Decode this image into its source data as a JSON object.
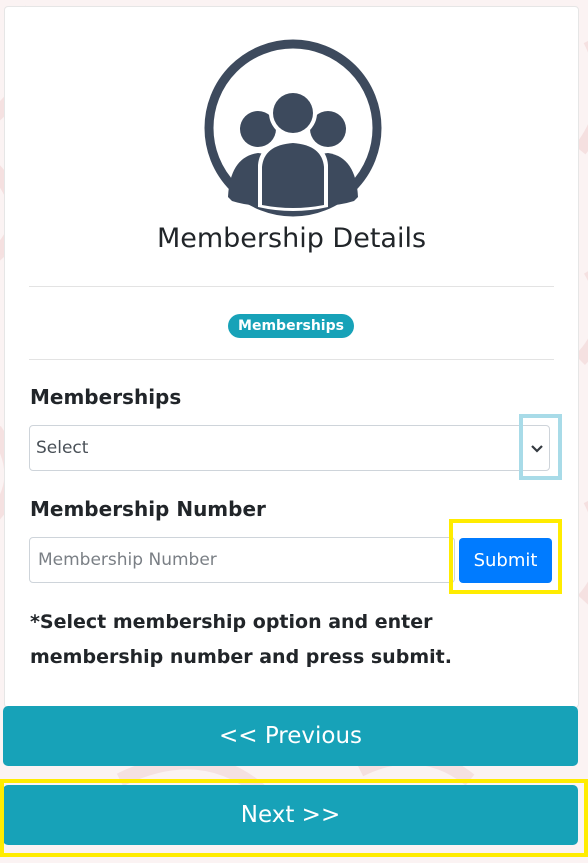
{
  "header": {
    "title": "Membership Details",
    "badge": "Memberships"
  },
  "form": {
    "membership_label": "Memberships",
    "membership_select": {
      "selected": "Select"
    },
    "number_label": "Membership Number",
    "number_input": {
      "value": "",
      "placeholder": "Membership Number"
    },
    "submit_label": "Submit",
    "note_line1": "*Select membership option and enter",
    "note_line2": "membership number and press submit."
  },
  "navigation": {
    "previous_label": "<< Previous",
    "next_label": "Next >>"
  },
  "icons": {
    "avatar": "group-users-icon",
    "select_arrow": "chevron-down-icon"
  },
  "colors": {
    "primary": "#007bff",
    "teal": "#17a2b8",
    "icon_dark": "#3d4a5d",
    "highlight_yellow": "#ffec00",
    "highlight_blue": "#a8dbe8"
  }
}
